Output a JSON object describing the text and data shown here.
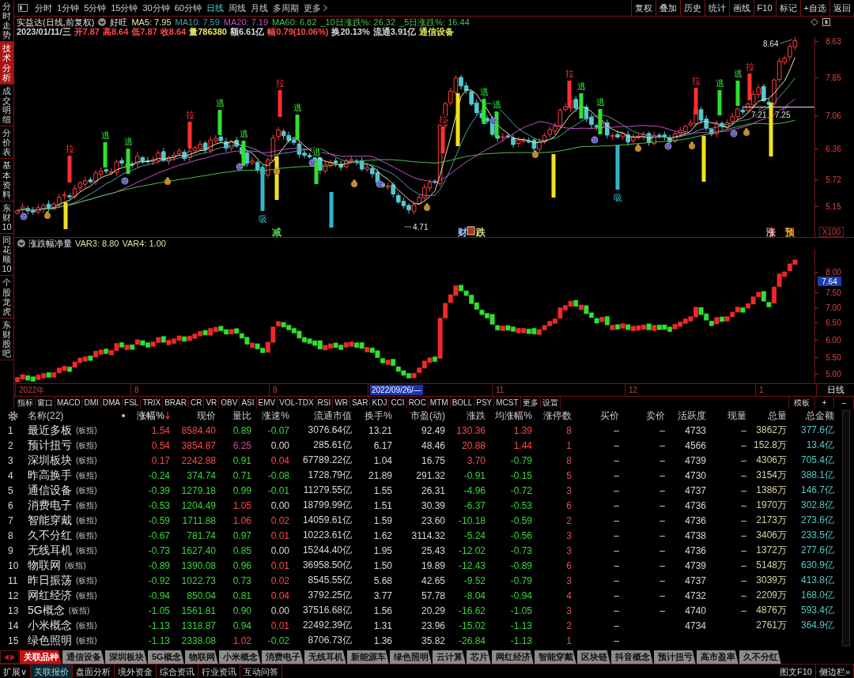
{
  "sidebar": {
    "tabs": [
      {
        "label": "分时走势",
        "selected": false
      },
      {
        "label": "技术分析",
        "selected": true
      },
      {
        "label": "成交明细",
        "selected": false
      },
      {
        "label": "分价表",
        "selected": false
      },
      {
        "label": "基本资料",
        "selected": false
      },
      {
        "label": "东财10",
        "selected": false
      },
      {
        "label": "同花顺10",
        "selected": false
      },
      {
        "label": "个股龙虎",
        "selected": false
      },
      {
        "label": "东财股吧",
        "selected": false
      }
    ]
  },
  "toolbar": {
    "periods": [
      {
        "label": "分时",
        "selected": false
      },
      {
        "label": "1分钟",
        "selected": false
      },
      {
        "label": "5分钟",
        "selected": false
      },
      {
        "label": "15分钟",
        "selected": false
      },
      {
        "label": "30分钟",
        "selected": false
      },
      {
        "label": "60分钟",
        "selected": false
      },
      {
        "label": "日线",
        "selected": true
      },
      {
        "label": "周线",
        "selected": false
      },
      {
        "label": "月线",
        "selected": false
      },
      {
        "label": "多周期",
        "selected": false
      }
    ],
    "more": "更多",
    "actions": [
      "复权",
      "叠加",
      "历史",
      "统计",
      "画线",
      "F10",
      "标记",
      "+自选",
      "返回"
    ]
  },
  "chart": {
    "title": "实益达(日线,前复权)",
    "pattern": "好旺",
    "indicators": [
      {
        "text": "MA5: 7.95",
        "kind": "ma",
        "color": "#e8e8b0"
      },
      {
        "text": "MA10: 7.59",
        "kind": "ma",
        "color": "#4aa0a8"
      },
      {
        "text": "MA20: 7.19",
        "kind": "ma",
        "color": "#c850c8"
      },
      {
        "text": "MA60: 6.82",
        "kind": "ma",
        "color": "#4cc04c"
      },
      {
        "text": "_10日涨跌%: 26.32",
        "kind": "change",
        "color": "#4cc04c"
      },
      {
        "text": "_5日涨跌%: 16.44",
        "kind": "change",
        "color": "#4cc04c"
      }
    ],
    "quote": [
      {
        "text": "2023/01/11/三",
        "color": "#d8d8d8"
      },
      {
        "text": "开7.87",
        "color": "#ff4a4a"
      },
      {
        "text": "高8.64",
        "color": "#ff4a4a"
      },
      {
        "text": "低7.87",
        "color": "#ff4a4a"
      },
      {
        "text": "收8.64",
        "color": "#ff4a4a"
      },
      {
        "text": "量786380",
        "color": "#e8e860"
      },
      {
        "text": "额6.61亿",
        "color": "#d8d8d8"
      },
      {
        "text": "幅0.79(10.06%)",
        "color": "#ff4a4a"
      },
      {
        "text": "换20.13%",
        "color": "#d8d8d8"
      },
      {
        "text": "流通3.91亿",
        "color": "#d8d8d8"
      },
      {
        "text": "通信设备",
        "color": "#e8e860"
      }
    ],
    "axis": [
      "8.63",
      "7.85",
      "7.06",
      "6.36",
      "5.72",
      "5.15"
    ],
    "scale": "X100",
    "signals": [
      {
        "text": "拉",
        "kind": "pull"
      },
      {
        "text": "逃",
        "kind": "escape"
      },
      {
        "text": "逃",
        "kind": "escape"
      },
      {
        "text": "拉",
        "kind": "pull"
      },
      {
        "text": "逃",
        "kind": "escape"
      },
      {
        "text": "逃",
        "kind": "escape"
      },
      {
        "text": "吸",
        "kind": "absorb"
      },
      {
        "text": "拉",
        "kind": "pull"
      },
      {
        "text": "逃",
        "kind": "escape"
      },
      {
        "text": "逃",
        "kind": "escape"
      },
      {
        "text": "拉",
        "kind": "pull"
      },
      {
        "text": "逃",
        "kind": "escape"
      },
      {
        "text": "逃",
        "kind": "escape"
      },
      {
        "text": "拉",
        "kind": "pull"
      },
      {
        "text": "逃",
        "kind": "escape"
      },
      {
        "text": "逃",
        "kind": "escape"
      },
      {
        "text": "吸",
        "kind": "absorb"
      },
      {
        "text": "拉",
        "kind": "pull"
      },
      {
        "text": "逃",
        "kind": "escape"
      },
      {
        "text": "逃",
        "kind": "escape"
      },
      {
        "text": "拉",
        "kind": "pull"
      }
    ],
    "events": [
      {
        "text": "减",
        "color": "#50d050",
        "boxed": false
      },
      {
        "text": "财",
        "color": "#90c8ff",
        "boxed": false
      },
      {
        "text": "跌",
        "color": "#e0e080",
        "boxed": true
      },
      {
        "text": "涨",
        "color": "#ffb0b0",
        "boxed": false
      },
      {
        "text": "预",
        "color": "#ffb030",
        "boxed": false
      }
    ],
    "callouts": [
      "8.64",
      "7.21",
      "7.25",
      "4.71"
    ]
  },
  "sub_chart": {
    "title": "涨跌幅净量",
    "indicators": [
      "VAR3: 8.80",
      "VAR4: 1.00"
    ],
    "axis": [
      {
        "text": "8.00",
        "selected": false
      },
      {
        "text": "7.64",
        "selected": true
      },
      {
        "text": "7.50",
        "selected": false
      },
      {
        "text": "7.00",
        "selected": false
      },
      {
        "text": "6.50",
        "selected": false
      },
      {
        "text": "6.00",
        "selected": false
      },
      {
        "text": "5.50",
        "selected": false
      },
      {
        "text": "5.00",
        "selected": false
      }
    ]
  },
  "time_axis": {
    "labels": [
      {
        "text": "2022年",
        "selected": false
      },
      {
        "text": "8",
        "selected": false
      },
      {
        "text": "9",
        "selected": false
      },
      {
        "text": "2022/09/26/—",
        "selected": true
      },
      {
        "text": "11",
        "selected": false
      },
      {
        "text": "12",
        "selected": false
      },
      {
        "text": "1",
        "selected": false
      }
    ],
    "period": "日线"
  },
  "indicator_bar": {
    "tabs": [
      "指标",
      "窗口",
      "MACD",
      "DMI",
      "DMA",
      "FSL",
      "TRIX",
      "BRAR",
      "CR",
      "VR",
      "OBV",
      "ASI",
      "EMV",
      "VOL-TDX",
      "RSI",
      "WR",
      "SAR",
      "KDJ",
      "CCI",
      "ROC",
      "MTM",
      "BOLL",
      "PSY",
      "MCST",
      "更多",
      "设置"
    ],
    "template": "模板",
    "controls": [
      "+",
      "–"
    ]
  },
  "table": {
    "columns": [
      {
        "label": "名称(22)",
        "kind": "name",
        "sorted": false
      },
      {
        "label": "涨幅%",
        "kind": "trend",
        "sorted": true
      },
      {
        "label": "现价",
        "kind": "trend",
        "sorted": false
      },
      {
        "label": "量比",
        "kind": "trend",
        "sorted": false
      },
      {
        "label": "涨速%",
        "kind": "trend",
        "sorted": false
      },
      {
        "label": "流通市值",
        "kind": "plain",
        "sorted": false
      },
      {
        "label": "换手%",
        "kind": "plain",
        "sorted": false
      },
      {
        "label": "市盈(动)",
        "kind": "plain",
        "sorted": false
      },
      {
        "label": "涨跌",
        "kind": "trend",
        "sorted": false
      },
      {
        "label": "均涨幅%",
        "kind": "trend",
        "sorted": false
      },
      {
        "label": "涨停数",
        "kind": "limit",
        "sorted": false
      },
      {
        "label": "买价",
        "kind": "plain",
        "sorted": false
      },
      {
        "label": "卖价",
        "kind": "plain",
        "sorted": false
      },
      {
        "label": "活跃度",
        "kind": "plain",
        "sorted": false
      },
      {
        "label": "现量",
        "kind": "plain",
        "sorted": false
      },
      {
        "label": "总量",
        "kind": "volume",
        "sorted": false
      },
      {
        "label": "总金额",
        "kind": "amount",
        "sorted": false
      }
    ],
    "rows": [
      {
        "index": "1",
        "cells": [
          {
            "text": "最近多板",
            "tag": "(板指)"
          },
          {
            "text": "1.54",
            "color": "#ff4848"
          },
          {
            "text": "8584.40",
            "color": "#ff4848"
          },
          {
            "text": "0.89",
            "color": "#3cd43c"
          },
          {
            "text": "-0.07",
            "color": "#3cd43c"
          },
          "3076.64亿",
          "13.21",
          "92.49",
          {
            "text": "130.36",
            "color": "#ff4848"
          },
          {
            "text": "1.39",
            "color": "#ff4848"
          },
          "8",
          "–",
          "–",
          "4733",
          "–",
          "3862万",
          "377.6亿"
        ]
      },
      {
        "index": "2",
        "cells": [
          {
            "text": "预计扭亏",
            "tag": "(板指)"
          },
          {
            "text": "0.54",
            "color": "#ff4848"
          },
          {
            "text": "3854.87",
            "color": "#ff4848"
          },
          {
            "text": "6.25",
            "color": "#c8508a"
          },
          {
            "text": "0.00",
            "color": "#d8d8d8"
          },
          "285.61亿",
          "6.17",
          "48.46",
          {
            "text": "20.88",
            "color": "#ff4848"
          },
          {
            "text": "1.44",
            "color": "#ff4848"
          },
          "1",
          "–",
          "–",
          "4566",
          "–",
          "152.8万",
          "13.4亿"
        ]
      },
      {
        "index": "3",
        "cells": [
          {
            "text": "深圳板块",
            "tag": "(板指)"
          },
          {
            "text": "0.17",
            "color": "#ff4848"
          },
          {
            "text": "2242.88",
            "color": "#ff4848"
          },
          {
            "text": "0.91",
            "color": "#3cd43c"
          },
          {
            "text": "0.04",
            "color": "#ff4848"
          },
          "67789.22亿",
          "1.04",
          "16.75",
          {
            "text": "3.70",
            "color": "#ff4848"
          },
          {
            "text": "-0.79",
            "color": "#3cd43c"
          },
          "8",
          "–",
          "–",
          "4739",
          "–",
          "4306万",
          "705.4亿"
        ]
      },
      {
        "index": "4",
        "cells": [
          {
            "text": "昨高换手",
            "tag": "(板指)"
          },
          {
            "text": "-0.24",
            "color": "#3cd43c"
          },
          {
            "text": "374.74",
            "color": "#3cd43c"
          },
          {
            "text": "0.71",
            "color": "#3cd43c"
          },
          {
            "text": "-0.08",
            "color": "#3cd43c"
          },
          "1728.79亿",
          "21.89",
          "291.32",
          {
            "text": "-0.91",
            "color": "#3cd43c"
          },
          {
            "text": "-0.15",
            "color": "#3cd43c"
          },
          "5",
          "–",
          "–",
          "4730",
          "–",
          "3154万",
          "388.1亿"
        ]
      },
      {
        "index": "5",
        "cells": [
          {
            "text": "通信设备",
            "tag": "(板指)"
          },
          {
            "text": "-0.39",
            "color": "#3cd43c"
          },
          {
            "text": "1279.18",
            "color": "#3cd43c"
          },
          {
            "text": "0.99",
            "color": "#3cd43c"
          },
          {
            "text": "-0.01",
            "color": "#3cd43c"
          },
          "11279.55亿",
          "1.55",
          "26.31",
          {
            "text": "-4.96",
            "color": "#3cd43c"
          },
          {
            "text": "-0.72",
            "color": "#3cd43c"
          },
          "3",
          "–",
          "–",
          "4737",
          "–",
          "1386万",
          "146.7亿"
        ]
      },
      {
        "index": "6",
        "cells": [
          {
            "text": "消费电子",
            "tag": "(板指)"
          },
          {
            "text": "-0.53",
            "color": "#3cd43c"
          },
          {
            "text": "1204.49",
            "color": "#3cd43c"
          },
          {
            "text": "1.05",
            "color": "#ff4848"
          },
          {
            "text": "0.00",
            "color": "#d8d8d8"
          },
          "18799.99亿",
          "1.51",
          "30.39",
          {
            "text": "-6.37",
            "color": "#3cd43c"
          },
          {
            "text": "-0.53",
            "color": "#3cd43c"
          },
          "6",
          "–",
          "–",
          "4736",
          "–",
          "1970万",
          "302.8亿"
        ]
      },
      {
        "index": "7",
        "cells": [
          {
            "text": "智能穿戴",
            "tag": "(板指)"
          },
          {
            "text": "-0.59",
            "color": "#3cd43c"
          },
          {
            "text": "1711.88",
            "color": "#3cd43c"
          },
          {
            "text": "1.06",
            "color": "#ff4848"
          },
          {
            "text": "0.02",
            "color": "#ff4848"
          },
          "14059.61亿",
          "1.59",
          "23.60",
          {
            "text": "-10.18",
            "color": "#3cd43c"
          },
          {
            "text": "-0.59",
            "color": "#3cd43c"
          },
          "2",
          "–",
          "–",
          "4736",
          "–",
          "2173万",
          "273.6亿"
        ]
      },
      {
        "index": "8",
        "cells": [
          {
            "text": "久不分红",
            "tag": "(板指)"
          },
          {
            "text": "-0.67",
            "color": "#3cd43c"
          },
          {
            "text": "781.74",
            "color": "#3cd43c"
          },
          {
            "text": "0.97",
            "color": "#3cd43c"
          },
          {
            "text": "0.01",
            "color": "#ff4848"
          },
          "10223.61亿",
          "1.62",
          "3114.32",
          {
            "text": "-5.24",
            "color": "#3cd43c"
          },
          {
            "text": "-0.56",
            "color": "#3cd43c"
          },
          "3",
          "–",
          "–",
          "4738",
          "–",
          "3406万",
          "233.5亿"
        ]
      },
      {
        "index": "9",
        "cells": [
          {
            "text": "无线耳机",
            "tag": "(板指)"
          },
          {
            "text": "-0.73",
            "color": "#3cd43c"
          },
          {
            "text": "1627.40",
            "color": "#3cd43c"
          },
          {
            "text": "0.85",
            "color": "#3cd43c"
          },
          {
            "text": "0.00",
            "color": "#d8d8d8"
          },
          "15244.40亿",
          "1.95",
          "25.43",
          {
            "text": "-12.02",
            "color": "#3cd43c"
          },
          {
            "text": "-0.73",
            "color": "#3cd43c"
          },
          "3",
          "–",
          "–",
          "4736",
          "–",
          "1372万",
          "277.6亿"
        ]
      },
      {
        "index": "10",
        "cells": [
          {
            "text": "物联网",
            "tag": "(板指)"
          },
          {
            "text": "-0.89",
            "color": "#3cd43c"
          },
          {
            "text": "1390.08",
            "color": "#3cd43c"
          },
          {
            "text": "0.96",
            "color": "#3cd43c"
          },
          {
            "text": "0.01",
            "color": "#ff4848"
          },
          "36958.50亿",
          "1.50",
          "19.89",
          {
            "text": "-12.43",
            "color": "#3cd43c"
          },
          {
            "text": "-0.89",
            "color": "#3cd43c"
          },
          "6",
          "–",
          "–",
          "4739",
          "–",
          "5148万",
          "630.9亿"
        ]
      },
      {
        "index": "11",
        "cells": [
          {
            "text": "昨日振荡",
            "tag": "(板指)"
          },
          {
            "text": "-0.92",
            "color": "#3cd43c"
          },
          {
            "text": "1022.73",
            "color": "#3cd43c"
          },
          {
            "text": "0.73",
            "color": "#3cd43c"
          },
          {
            "text": "0.02",
            "color": "#ff4848"
          },
          "8545.55亿",
          "5.68",
          "42.65",
          {
            "text": "-9.52",
            "color": "#3cd43c"
          },
          {
            "text": "-0.79",
            "color": "#3cd43c"
          },
          "3",
          "–",
          "–",
          "4737",
          "–",
          "3039万",
          "413.8亿"
        ]
      },
      {
        "index": "12",
        "cells": [
          {
            "text": "网红经济",
            "tag": "(板指)"
          },
          {
            "text": "-0.94",
            "color": "#3cd43c"
          },
          {
            "text": "850.04",
            "color": "#3cd43c"
          },
          {
            "text": "0.81",
            "color": "#3cd43c"
          },
          {
            "text": "0.04",
            "color": "#ff4848"
          },
          "3792.25亿",
          "3.77",
          "57.78",
          {
            "text": "-8.04",
            "color": "#3cd43c"
          },
          {
            "text": "-0.94",
            "color": "#3cd43c"
          },
          "4",
          "–",
          "–",
          "4732",
          "–",
          "2209万",
          "168.0亿"
        ]
      },
      {
        "index": "13",
        "cells": [
          {
            "text": "5G概念",
            "tag": "(板指)"
          },
          {
            "text": "-1.05",
            "color": "#3cd43c"
          },
          {
            "text": "1561.81",
            "color": "#3cd43c"
          },
          {
            "text": "0.90",
            "color": "#3cd43c"
          },
          {
            "text": "0.00",
            "color": "#d8d8d8"
          },
          "37516.68亿",
          "1.56",
          "20.29",
          {
            "text": "-16.62",
            "color": "#3cd43c"
          },
          {
            "text": "-1.05",
            "color": "#3cd43c"
          },
          "3",
          "–",
          "–",
          "4740",
          "–",
          "4876万",
          "593.4亿"
        ]
      },
      {
        "index": "14",
        "cells": [
          {
            "text": "小米概念",
            "tag": "(板指)"
          },
          {
            "text": "-1.13",
            "color": "#3cd43c"
          },
          {
            "text": "1318.87",
            "color": "#3cd43c"
          },
          {
            "text": "0.94",
            "color": "#3cd43c"
          },
          {
            "text": "0.01",
            "color": "#ff4848"
          },
          "22492.39亿",
          "1.31",
          "23.96",
          {
            "text": "-15.02",
            "color": "#3cd43c"
          },
          {
            "text": "-1.13",
            "color": "#3cd43c"
          },
          "2",
          "–",
          "",
          "4734",
          "",
          "2761万",
          "364.9亿"
        ]
      },
      {
        "index": "15",
        "cells": [
          {
            "text": "绿色照明",
            "tag": "(板指)"
          },
          {
            "text": "-1.13",
            "color": "#3cd43c"
          },
          {
            "text": "2338.08",
            "color": "#3cd43c"
          },
          {
            "text": "1.02",
            "color": "#ff4848"
          },
          {
            "text": "-0.02",
            "color": "#3cd43c"
          },
          "8706.73亿",
          "1.36",
          "35.82",
          {
            "text": "-26.84",
            "color": "#3cd43c"
          },
          {
            "text": "-1.13",
            "color": "#3cd43c"
          },
          "1",
          "–"
        ]
      }
    ]
  },
  "related_tabs": [
    {
      "label": "关联品种",
      "selected": true
    },
    {
      "label": "通信设备",
      "selected": false
    },
    {
      "label": "深圳板块",
      "selected": false
    },
    {
      "label": "5G概念",
      "selected": false
    },
    {
      "label": "物联网",
      "selected": false
    },
    {
      "label": "小米概念",
      "selected": false
    },
    {
      "label": "消费电子",
      "selected": false
    },
    {
      "label": "无线耳机",
      "selected": false
    },
    {
      "label": "新能源车",
      "selected": false
    },
    {
      "label": "绿色照明",
      "selected": false
    },
    {
      "label": "云计算",
      "selected": false
    },
    {
      "label": "芯片",
      "selected": false
    },
    {
      "label": "网红经济",
      "selected": false
    },
    {
      "label": "智能穿戴",
      "selected": false
    },
    {
      "label": "区块链",
      "selected": false
    },
    {
      "label": "抖音概念",
      "selected": false
    },
    {
      "label": "预计扭亏",
      "selected": false
    },
    {
      "label": "高市盈率",
      "selected": false
    },
    {
      "label": "久不分红",
      "selected": false
    }
  ],
  "bottom_bar": {
    "tabs": [
      {
        "label": "扩展∨",
        "selected": false
      },
      {
        "label": "关联报价",
        "selected": true
      },
      {
        "label": "盘面分析",
        "selected": false
      },
      {
        "label": "境外资金",
        "selected": false
      },
      {
        "label": "综合资讯",
        "selected": false
      },
      {
        "label": "行业资讯",
        "selected": false
      },
      {
        "label": "互动问答",
        "selected": false
      }
    ],
    "links": [
      "图文F10",
      "侧边栏»"
    ]
  }
}
